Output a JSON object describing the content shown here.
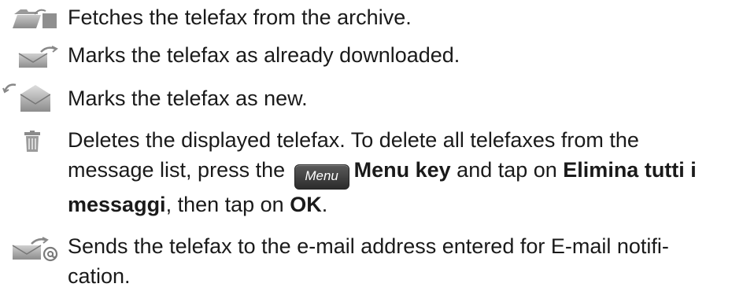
{
  "items": [
    {
      "icon": "folder-archive-icon",
      "text": "Fetches the telefax from the archive."
    },
    {
      "icon": "envelope-read-icon",
      "text": "Marks the telefax as already downloaded."
    },
    {
      "icon": "envelope-open-icon",
      "text": "Marks the telefax as new."
    },
    {
      "icon": "trash-icon",
      "line1": "Deletes the displayed telefax. To delete all telefaxes from the",
      "line2_pre": "message list, press the ",
      "menu_key_label": "Menu",
      "menu_key_bold": "Menu key",
      "line2_mid": " and tap on ",
      "bold1": "Elimina tutti i",
      "bold2": "messaggi",
      "line3_mid": ", then tap on ",
      "bold3": "OK",
      "line3_end": "."
    },
    {
      "icon": "envelope-email-icon",
      "line1": "Sends the telefax to the e-mail address entered for E-mail notifi-",
      "line2": "cation."
    }
  ]
}
